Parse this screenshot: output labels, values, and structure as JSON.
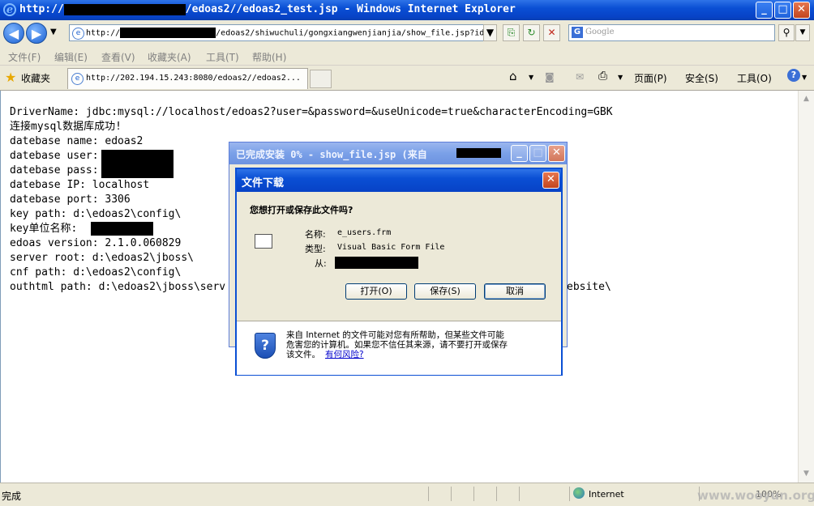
{
  "window": {
    "title_prefix": "http://",
    "title_suffix": "/edoas2//edoas2_test.jsp - Windows Internet Explorer",
    "buttons": {
      "minimize": "_",
      "maximize": "□",
      "close": "✕"
    }
  },
  "address_bar": {
    "prefix": "http://",
    "suffix": "/edoas2/shiwuchuli/gongxiangwenjianjia/show_file.jsp?id"
  },
  "search": {
    "placeholder": "Google"
  },
  "menu": [
    "文件(F)",
    "编辑(E)",
    "查看(V)",
    "收藏夹(A)",
    "工具(T)",
    "帮助(H)"
  ],
  "favorites_label": "收藏夹",
  "tab": {
    "title": "http://202.194.15.243:8080/edoas2//edoas2..."
  },
  "command_bar": {
    "page": "页面(P)",
    "safety": "安全(S)",
    "tools": "工具(O)"
  },
  "content_lines": [
    "DriverName: jdbc:mysql://localhost/edoas2?user=&password=&useUnicode=true&characterEncoding=GBK",
    "连接mysql数据库成功!",
    "datebase name: edoas2",
    "datebase user:",
    "datebase pass:",
    "datebase IP: localhost",
    "datebase port: 3306",
    "key path: d:\\edoas2\\config\\",
    "key单位名称:",
    "edoas version: 2.1.0.060829",
    "server root: d:\\edoas2\\jboss\\",
    "cnf path: d:\\edoas2\\config\\",
    "outhtml path: d:\\edoas2\\jboss\\serv",
    "ebsite\\"
  ],
  "progress_window": {
    "title": "已完成安装 0% - show_file.jsp (来自"
  },
  "download_dialog": {
    "title": "文件下载",
    "question": "您想打开或保存此文件吗?",
    "name_label": "名称:",
    "name_value": "e_users.frm",
    "type_label": "类型:",
    "type_value": "Visual Basic Form File",
    "from_label": "从:",
    "open_button": "打开(O)",
    "save_button": "保存(S)",
    "cancel_button": "取消",
    "warning_line1": "来自 Internet 的文件可能对您有所帮助，但某些文件可能",
    "warning_line2": "危害您的计算机。如果您不信任其来源，请不要打开或保存",
    "warning_line3": "该文件。",
    "risk_link": "有何风险?"
  },
  "status": {
    "text": "完成",
    "zone": "Internet",
    "zoom": "100%"
  },
  "watermark": "www.wooyun.org"
}
